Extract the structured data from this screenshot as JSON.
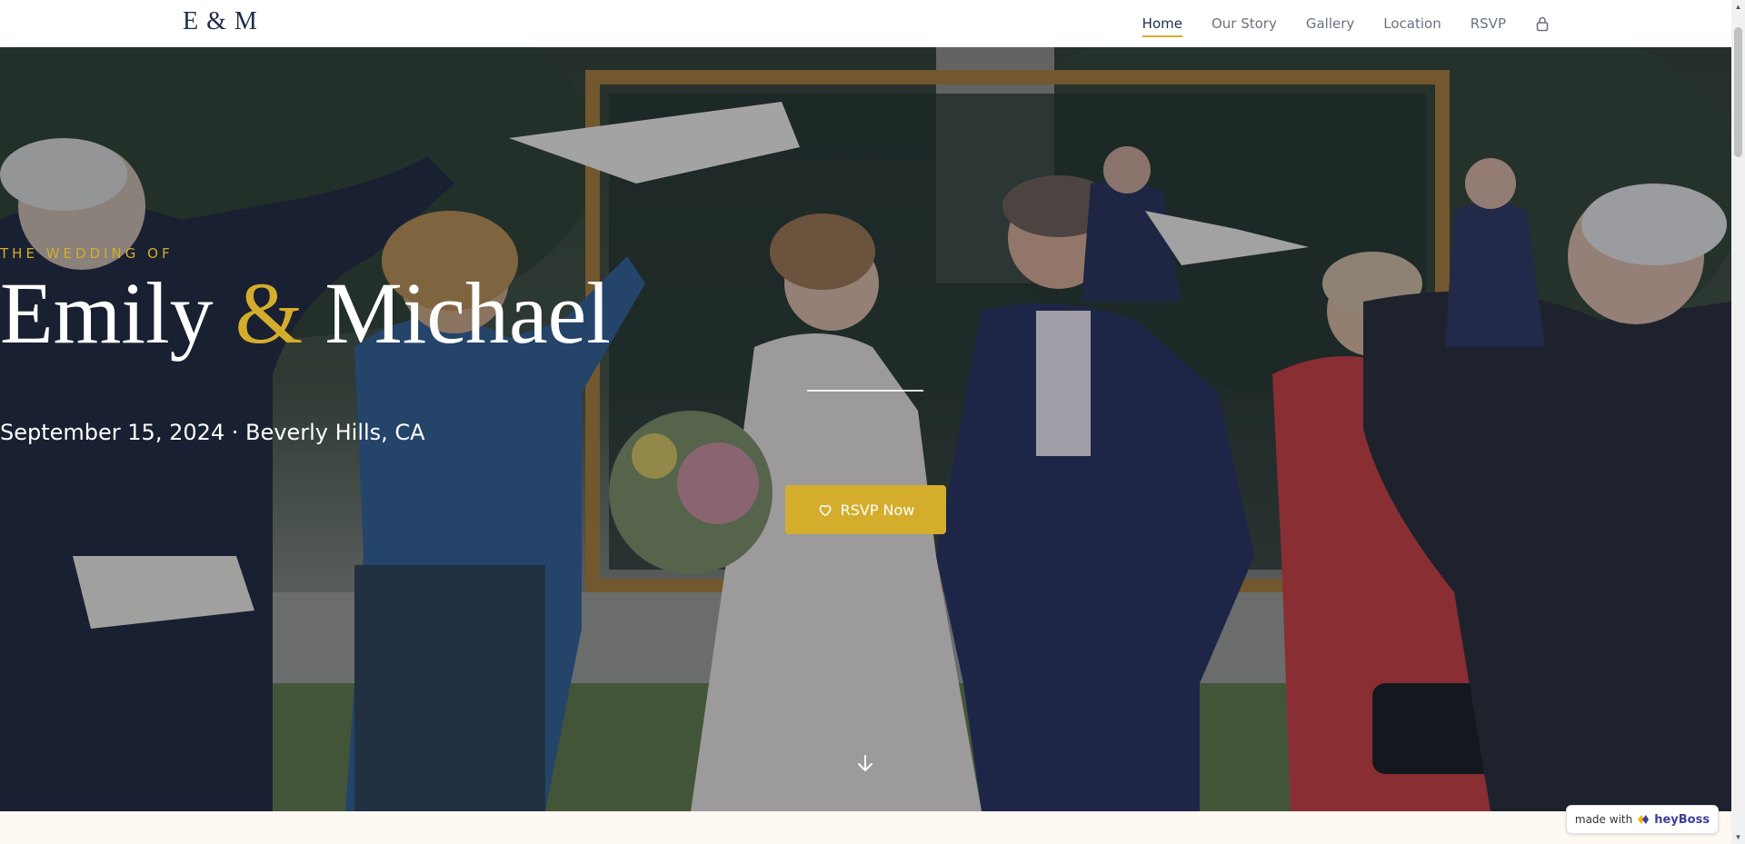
{
  "nav": {
    "logo": "E & M",
    "links": [
      {
        "label": "Home",
        "active": true
      },
      {
        "label": "Our Story",
        "active": false
      },
      {
        "label": "Gallery",
        "active": false
      },
      {
        "label": "Location",
        "active": false
      },
      {
        "label": "RSVP",
        "active": false
      }
    ],
    "lock_icon": "lock-icon"
  },
  "hero": {
    "eyebrow": "THE WEDDING OF",
    "name_first": "Emily",
    "ampersand": "&",
    "name_second": "Michael",
    "date_location": "September 15, 2024 · Beverly Hills, CA",
    "cta_label": "RSVP Now",
    "cta_icon": "heart-icon",
    "scroll_icon": "arrow-down-icon"
  },
  "badge": {
    "prefix": "made with",
    "brand": "heyBoss"
  },
  "colors": {
    "accent": "#d4ad2d",
    "navy": "#1f2d4a",
    "nav_text": "#6b7280"
  }
}
